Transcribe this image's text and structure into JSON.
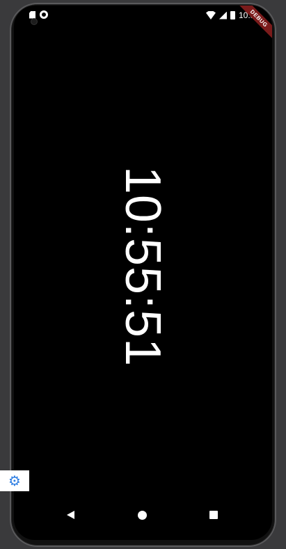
{
  "status_bar": {
    "time": "10:55"
  },
  "debug_banner": {
    "label": "DEBUG"
  },
  "clock": {
    "time": "10:55:51",
    "orientation": "rotated-90"
  },
  "nav": {
    "back_icon": "back-icon",
    "home_icon": "home-icon",
    "recents_icon": "recents-icon"
  },
  "settings_button": {
    "icon": "gear-icon",
    "glyph": "⚙",
    "color": "#2f7fe3"
  }
}
